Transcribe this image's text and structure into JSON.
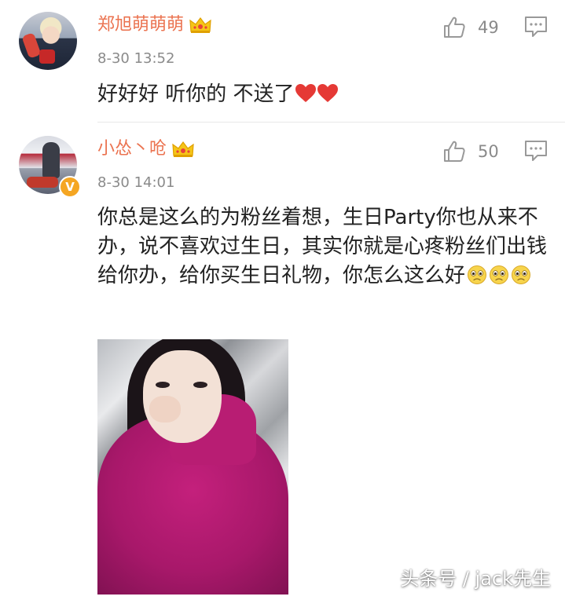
{
  "colors": {
    "username": "#eb7350",
    "meta_gray": "#8a8a8a",
    "body_text": "#222222",
    "divider": "#e8e8e8",
    "verified_badge": "#f5a623"
  },
  "comments": [
    {
      "username": "郑旭萌萌萌",
      "badge": "crown-icon",
      "timestamp": "8-30 13:52",
      "likes": "49",
      "text": "好好好 听你的 不送了",
      "emojis": [
        "heart-icon",
        "heart-icon"
      ]
    },
    {
      "username": "小怂丶呛",
      "badge": "crown-icon",
      "verified": "V",
      "timestamp": "8-30 14:01",
      "likes": "50",
      "text": "你总是这么的为粉丝着想，生日Party你也从来不办，说不喜欢过生日，其实你就是心疼粉丝们出钱给你办，给你买生日礼物，你怎么这么好",
      "emojis": [
        "sad-face-icon",
        "sad-face-icon",
        "sad-face-icon"
      ],
      "has_photo": true
    }
  ],
  "watermark": "头条号 / jack先生"
}
